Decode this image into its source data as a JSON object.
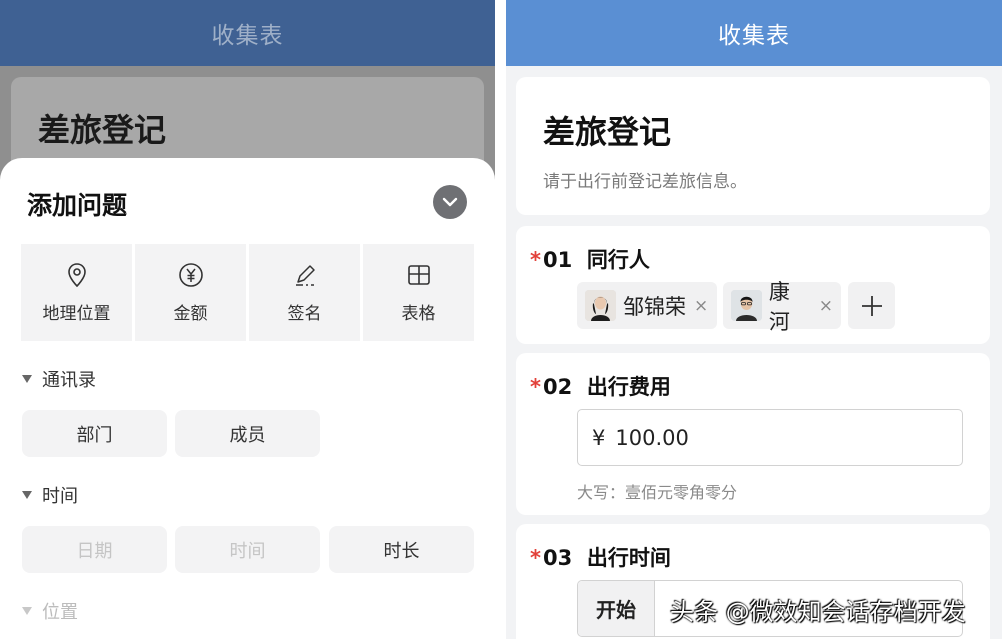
{
  "left": {
    "app_title": "收集表",
    "form_title_behind": "差旅登记",
    "sheet": {
      "title": "添加问题",
      "tiles": [
        {
          "label": "地理位置",
          "icon": "location-icon"
        },
        {
          "label": "金额",
          "icon": "currency-yuan-icon"
        },
        {
          "label": "签名",
          "icon": "signature-pen-icon"
        },
        {
          "label": "表格",
          "icon": "table-grid-icon"
        }
      ],
      "sections": [
        {
          "title": "通讯录",
          "items": [
            {
              "label": "部门"
            },
            {
              "label": "成员"
            }
          ]
        },
        {
          "title": "时间",
          "items": [
            {
              "label": "日期",
              "disabled": true
            },
            {
              "label": "时间",
              "disabled": true
            },
            {
              "label": "时长",
              "disabled": false
            }
          ]
        },
        {
          "title": "位置",
          "disabled": true
        }
      ]
    }
  },
  "right": {
    "app_title": "收集表",
    "form": {
      "title": "差旅登记",
      "description": "请于出行前登记差旅信息。"
    },
    "questions": [
      {
        "number": "01",
        "required_mark": "*",
        "title": "同行人",
        "people": [
          {
            "name": "邹锦荣",
            "remove": "×"
          },
          {
            "name": "康河",
            "remove": "×"
          }
        ],
        "add_label": "+"
      },
      {
        "number": "02",
        "required_mark": "*",
        "title": "出行费用",
        "currency": "¥",
        "value": "100.00",
        "uppercase_hint": "大写：壹佰元零角零分"
      },
      {
        "number": "03",
        "required_mark": "*",
        "title": "出行时间",
        "start_label": "开始"
      }
    ]
  },
  "watermark": "头条 @微效知会话存档开发",
  "colors": {
    "left_topbar": "#3f6193",
    "right_topbar": "#5a8fd3",
    "required": "#e2413a",
    "overlay": "#8f8f8f"
  }
}
